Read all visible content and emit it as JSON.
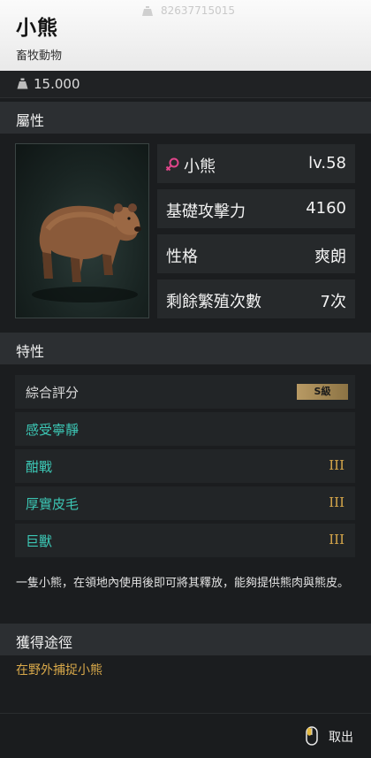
{
  "header": {
    "title": "小熊",
    "subtitle": "畜牧動物",
    "ghost_text": "82637715015"
  },
  "weight": {
    "value": "15.000",
    "icon": "weight-icon"
  },
  "attributes": {
    "heading": "屬性",
    "name": "小熊",
    "level": "lv.58",
    "base_attack_label": "基礎攻擊力",
    "base_attack_value": "4160",
    "personality_label": "性格",
    "personality_value": "爽朗",
    "breeding_label": "剩餘繁殖次數",
    "breeding_value": "7次",
    "gender_icon": "female-icon",
    "gender_color": "#e0458a"
  },
  "traits": {
    "heading": "特性",
    "rating_label": "綜合評分",
    "rating_value": "S級",
    "items": [
      {
        "name": "感受寧靜",
        "rank": ""
      },
      {
        "name": "酣戰",
        "rank": "III"
      },
      {
        "name": "厚實皮毛",
        "rank": "III"
      },
      {
        "name": "巨獸",
        "rank": "III"
      }
    ]
  },
  "description": "一隻小熊，在領地內使用後即可將其釋放，能夠提供熊肉與熊皮。",
  "acquisition": {
    "heading": "獲得途徑",
    "text": "在野外捕捉小熊"
  },
  "footer": {
    "take_out_label": "取出",
    "icon": "mouse-icon"
  },
  "colors": {
    "accent_teal": "#3cc7b5",
    "accent_gold": "#d6a64a"
  }
}
